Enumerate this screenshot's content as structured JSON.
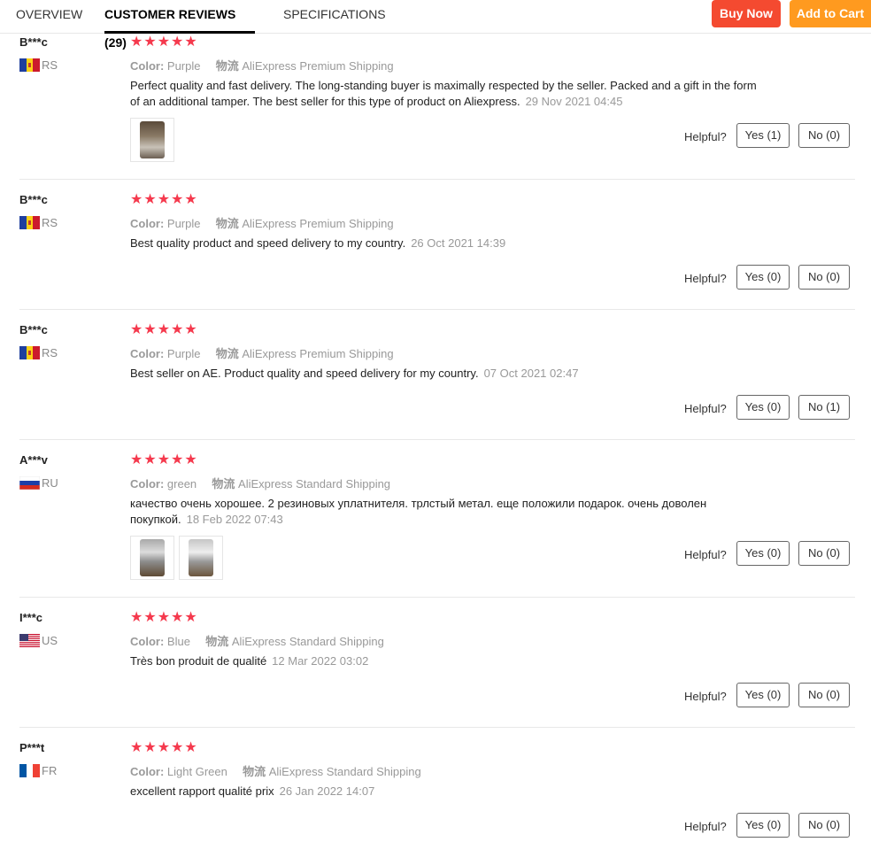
{
  "tabs": {
    "overview": "OVERVIEW",
    "reviews": "CUSTOMER REVIEWS (29)",
    "specs": "SPECIFICATIONS"
  },
  "buttons": {
    "buy_now": "Buy Now",
    "add_to_cart": "Add to Cart"
  },
  "labels": {
    "color": "Color:",
    "shipping": "物流",
    "helpful": "Helpful?"
  },
  "stars": "★★★★★",
  "reviews": [
    {
      "user": "B***c",
      "country": "RS",
      "flag": "rs",
      "color": "Purple",
      "shipping": "AliExpress Premium Shipping",
      "text": "Perfect quality and fast delivery. The long-standing buyer is maximally respected by the seller. Packed and a gift in the form of an additional tamper. The best seller for this type of product on Aliexpress.",
      "date": "29 Nov 2021 04:45",
      "yes": "Yes (1)",
      "no": "No (0)",
      "photos": 1
    },
    {
      "user": "B***c",
      "country": "RS",
      "flag": "rs",
      "color": "Purple",
      "shipping": "AliExpress Premium Shipping",
      "text": "Best quality product and speed delivery to my country.",
      "date": "26 Oct 2021 14:39",
      "yes": "Yes (0)",
      "no": "No (0)",
      "photos": 0
    },
    {
      "user": "B***c",
      "country": "RS",
      "flag": "rs",
      "color": "Purple",
      "shipping": "AliExpress Premium Shipping",
      "text": "Best seller on AE. Product quality and speed delivery for my country.",
      "date": "07 Oct 2021 02:47",
      "yes": "Yes (0)",
      "no": "No (1)",
      "photos": 0
    },
    {
      "user": "A***v",
      "country": "RU",
      "flag": "ru",
      "color": "green",
      "shipping": "AliExpress Standard Shipping",
      "text": "качество очень хорошее. 2 резиновых уплатнителя. трлстый метал. еще положили подарок. очень доволен покупкой.",
      "date": "18 Feb 2022 07:43",
      "yes": "Yes (0)",
      "no": "No (0)",
      "photos": 2
    },
    {
      "user": "I***c",
      "country": "US",
      "flag": "us",
      "color": "Blue",
      "shipping": "AliExpress Standard Shipping",
      "text": "Très bon produit de qualité",
      "date": "12 Mar 2022 03:02",
      "yes": "Yes (0)",
      "no": "No (0)",
      "photos": 0
    },
    {
      "user": "P***t",
      "country": "FR",
      "flag": "fr",
      "color": "Light Green",
      "shipping": "AliExpress Standard Shipping",
      "text": "excellent rapport qualité prix",
      "date": "26 Jan 2022 14:07",
      "yes": "Yes (0)",
      "no": "No (0)",
      "photos": 0
    }
  ]
}
